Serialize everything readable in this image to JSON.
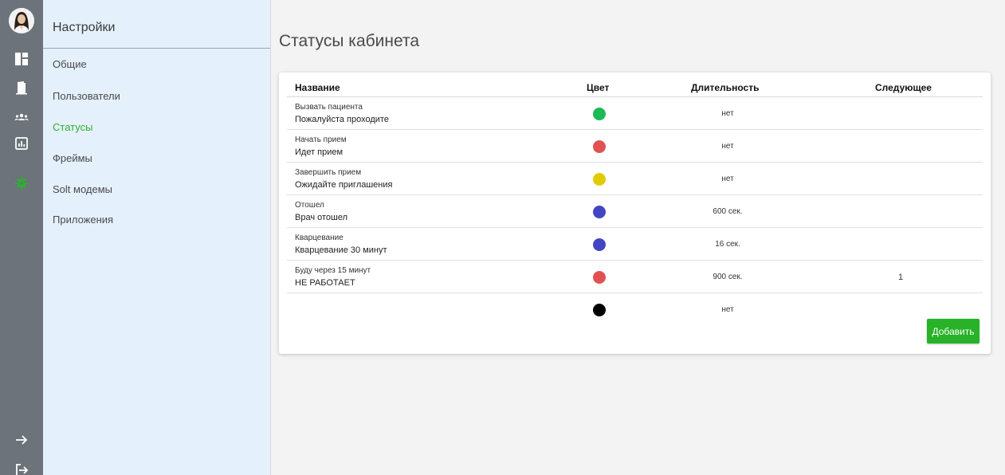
{
  "sidebar": {
    "title": "Настройки",
    "items": [
      {
        "label": "Общие"
      },
      {
        "label": "Пользователи"
      },
      {
        "label": "Статусы"
      },
      {
        "label": "Фреймы"
      },
      {
        "label": "Solt модемы"
      },
      {
        "label": "Приложения"
      }
    ],
    "active_index": 2
  },
  "rail": {
    "icons": [
      "avatar",
      "dashboard-icon",
      "door-icon",
      "users-icon",
      "chart-icon",
      "settings-gear-icon",
      "arrow-right-icon",
      "logout-icon"
    ],
    "accent_color": "#2fae2f"
  },
  "main": {
    "title": "Статусы кабинета",
    "table": {
      "columns": [
        "Название",
        "Цвет",
        "Длительность",
        "Следующее"
      ],
      "rows": [
        {
          "name": "Вызвать пациента",
          "subtitle": "Пожалуйста проходите",
          "color": "#1db954",
          "duration": "нет",
          "next": ""
        },
        {
          "name": "Начать прием",
          "subtitle": "Идет прием",
          "color": "#e05252",
          "duration": "нет",
          "next": ""
        },
        {
          "name": "Завершить прием",
          "subtitle": "Ожидайте приглашения",
          "color": "#e0cc00",
          "duration": "нет",
          "next": ""
        },
        {
          "name": "Отошел",
          "subtitle": "Врач отошел",
          "color": "#4346c2",
          "duration": "600 сек.",
          "next": ""
        },
        {
          "name": "Кварцевание",
          "subtitle": "Кварцевание 30 минут",
          "color": "#4346c2",
          "duration": "16 сек.",
          "next": ""
        },
        {
          "name": "Буду через 15 минут",
          "subtitle": "НЕ РАБОТАЕТ",
          "color": "#e05252",
          "duration": "900 сек.",
          "next": "1"
        },
        {
          "name": "",
          "subtitle": "",
          "color": "#000000",
          "duration": "нет",
          "next": ""
        }
      ]
    },
    "add_button": "Добавить",
    "add_button_color": "#27b227"
  }
}
